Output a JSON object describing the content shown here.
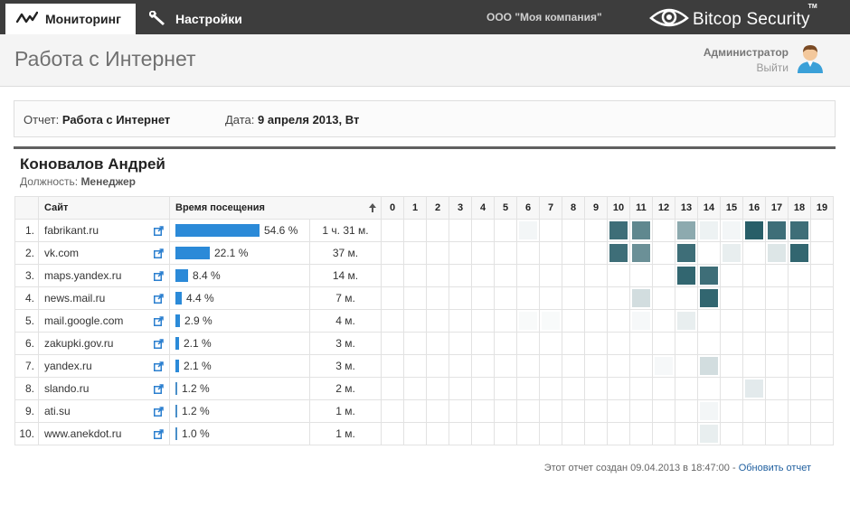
{
  "nav": {
    "monitoring_label": "Мониторинг",
    "settings_label": "Настройки",
    "company": "ООО \"Моя компания\"",
    "brand": "Bitcop Security",
    "tm": "TM"
  },
  "header": {
    "title": "Работа с Интернет",
    "user": "Администратор",
    "logout": "Выйти"
  },
  "report": {
    "report_label": "Отчет:",
    "report_value": "Работа с Интернет",
    "date_label": "Дата:",
    "date_value": "9 апреля 2013, Вт"
  },
  "employee": {
    "name": "Коновалов Андрей",
    "position_label": "Должность:",
    "position_value": "Менеджер"
  },
  "table": {
    "col_site": "Сайт",
    "col_time": "Время посещения",
    "hours": [
      "0",
      "1",
      "2",
      "3",
      "4",
      "5",
      "6",
      "7",
      "8",
      "9",
      "10",
      "11",
      "12",
      "13",
      "14",
      "15",
      "16",
      "17",
      "18",
      "19"
    ],
    "rows": [
      {
        "num": "1.",
        "site": "fabrikant.ru",
        "percent": "54.6 %",
        "share": 0.546,
        "duration": "1 ч. 31 м.",
        "heat": [
          0,
          0,
          0,
          0,
          0,
          0,
          0.05,
          0,
          0,
          0,
          0.85,
          0.7,
          0,
          0.5,
          0.08,
          0.05,
          0.95,
          0.85,
          0.85,
          0
        ]
      },
      {
        "num": "2.",
        "site": "vk.com",
        "percent": "22.1 %",
        "share": 0.221,
        "duration": "37 м.",
        "heat": [
          0,
          0,
          0,
          0,
          0,
          0,
          0,
          0,
          0,
          0,
          0.85,
          0.65,
          0,
          0.85,
          0,
          0.1,
          0,
          0.15,
          0.9,
          0
        ]
      },
      {
        "num": "3.",
        "site": "maps.yandex.ru",
        "percent": "8.4 %",
        "share": 0.084,
        "duration": "14 м.",
        "heat": [
          0,
          0,
          0,
          0,
          0,
          0,
          0,
          0,
          0,
          0,
          0,
          0,
          0,
          0.9,
          0.85,
          0,
          0,
          0,
          0,
          0
        ]
      },
      {
        "num": "4.",
        "site": "news.mail.ru",
        "percent": "4.4 %",
        "share": 0.044,
        "duration": "7 м.",
        "heat": [
          0,
          0,
          0,
          0,
          0,
          0,
          0,
          0,
          0,
          0,
          0,
          0.2,
          0,
          0,
          0.9,
          0,
          0,
          0,
          0,
          0
        ]
      },
      {
        "num": "5.",
        "site": "mail.google.com",
        "percent": "2.9 %",
        "share": 0.029,
        "duration": "4 м.",
        "heat": [
          0,
          0,
          0,
          0,
          0,
          0,
          0.03,
          0.03,
          0,
          0,
          0,
          0.04,
          0,
          0.1,
          0,
          0,
          0,
          0,
          0,
          0
        ]
      },
      {
        "num": "6.",
        "site": "zakupki.gov.ru",
        "percent": "2.1 %",
        "share": 0.021,
        "duration": "3 м.",
        "heat": [
          0,
          0,
          0,
          0,
          0,
          0,
          0,
          0,
          0,
          0,
          0,
          0,
          0,
          0,
          0,
          0,
          0,
          0,
          0,
          0
        ]
      },
      {
        "num": "7.",
        "site": "yandex.ru",
        "percent": "2.1 %",
        "share": 0.021,
        "duration": "3 м.",
        "heat": [
          0,
          0,
          0,
          0,
          0,
          0,
          0,
          0,
          0,
          0,
          0,
          0,
          0.04,
          0,
          0.2,
          0,
          0,
          0,
          0,
          0
        ]
      },
      {
        "num": "8.",
        "site": "slando.ru",
        "percent": "1.2 %",
        "share": 0.012,
        "duration": "2 м.",
        "heat": [
          0,
          0,
          0,
          0,
          0,
          0,
          0,
          0,
          0,
          0,
          0,
          0,
          0,
          0,
          0,
          0,
          0.12,
          0,
          0,
          0
        ]
      },
      {
        "num": "9.",
        "site": "ati.su",
        "percent": "1.2 %",
        "share": 0.012,
        "duration": "1 м.",
        "heat": [
          0,
          0,
          0,
          0,
          0,
          0,
          0,
          0,
          0,
          0,
          0,
          0,
          0,
          0,
          0.05,
          0,
          0,
          0,
          0,
          0
        ]
      },
      {
        "num": "10.",
        "site": "www.anekdot.ru",
        "percent": "1.0 %",
        "share": 0.01,
        "duration": "1 м.",
        "heat": [
          0,
          0,
          0,
          0,
          0,
          0,
          0,
          0,
          0,
          0,
          0,
          0,
          0,
          0,
          0.1,
          0,
          0,
          0,
          0,
          0
        ]
      }
    ]
  },
  "footer": {
    "created_text": "Этот отчет создан 09.04.2013 в 18:47:00 - ",
    "refresh_link": "Обновить отчет"
  },
  "colors": {
    "heat": "#1c5560",
    "bar": "#2b8ad8",
    "topbar": "#3d3d3d"
  }
}
